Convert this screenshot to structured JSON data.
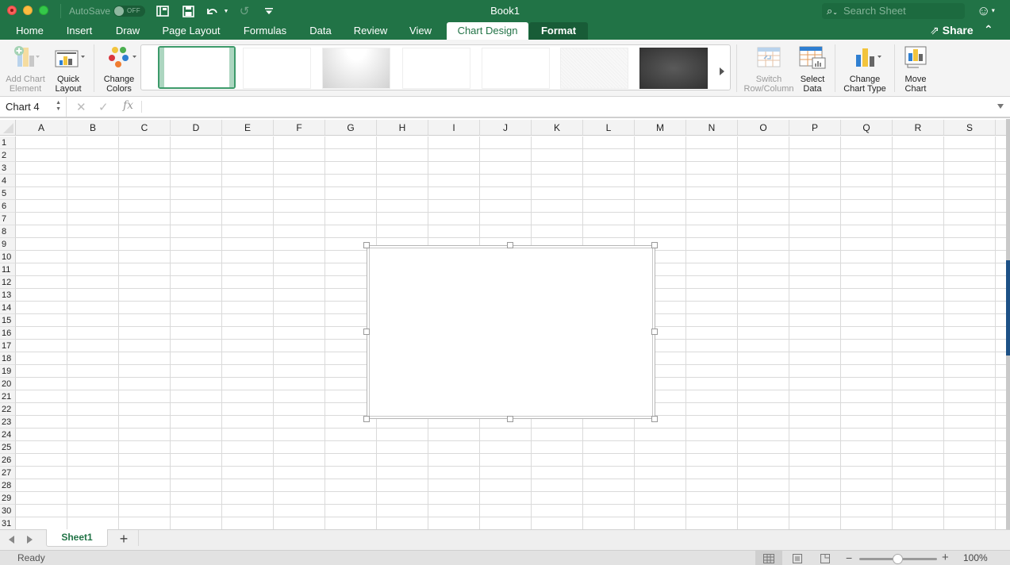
{
  "window": {
    "title": "Book1",
    "autosave_label": "AutoSave",
    "autosave_state": "OFF",
    "search_placeholder": "Search Sheet"
  },
  "quick_access": [
    {
      "name": "sidebar-toggle-icon",
      "glyph": "▯"
    },
    {
      "name": "save-icon",
      "glyph": "💾"
    },
    {
      "name": "undo-icon",
      "glyph": "↶"
    },
    {
      "name": "redo-icon",
      "glyph": "↻"
    },
    {
      "name": "customize-icon",
      "glyph": "⏷"
    }
  ],
  "tabs": [
    {
      "label": "Home"
    },
    {
      "label": "Insert"
    },
    {
      "label": "Draw"
    },
    {
      "label": "Page Layout"
    },
    {
      "label": "Formulas"
    },
    {
      "label": "Data"
    },
    {
      "label": "Review"
    },
    {
      "label": "View"
    },
    {
      "label": "Chart Design",
      "active": true
    },
    {
      "label": "Format"
    }
  ],
  "share_label": "Share",
  "ribbon": {
    "add_chart_element": {
      "line1": "Add Chart",
      "line2": "Element",
      "disabled": true
    },
    "quick_layout": {
      "line1": "Quick",
      "line2": "Layout"
    },
    "change_colors": {
      "line1": "Change",
      "line2": "Colors"
    },
    "chart_styles": [
      {
        "style": "Style 1",
        "selected": true
      },
      {
        "style": "Style 2"
      },
      {
        "style": "Style 3"
      },
      {
        "style": "Style 4"
      },
      {
        "style": "Style 5"
      },
      {
        "style": "Style 6"
      },
      {
        "style": "Style 7"
      }
    ],
    "switch_row_column": {
      "line1": "Switch",
      "line2": "Row/Column",
      "disabled": true
    },
    "select_data": {
      "line1": "Select",
      "line2": "Data"
    },
    "change_chart_type": {
      "line1": "Change",
      "line2": "Chart Type"
    },
    "move_chart": {
      "line1": "Move",
      "line2": "Chart"
    }
  },
  "formula_bar": {
    "name_box": "Chart 4",
    "cancel_glyph": "✕",
    "enter_glyph": "✓",
    "fx_label": "fx",
    "value": ""
  },
  "grid": {
    "columns": [
      "A",
      "B",
      "C",
      "D",
      "E",
      "F",
      "G",
      "H",
      "I",
      "J",
      "K",
      "L",
      "M",
      "N",
      "O",
      "P",
      "Q",
      "R",
      "S"
    ],
    "rows": [
      "1",
      "2",
      "3",
      "4",
      "5",
      "6",
      "7",
      "8",
      "9",
      "10",
      "11",
      "12",
      "13",
      "14",
      "15",
      "16",
      "17",
      "18",
      "19",
      "20",
      "21",
      "22",
      "23",
      "24",
      "25",
      "26",
      "27",
      "28",
      "29",
      "30",
      "31"
    ]
  },
  "chart": {
    "name": "Chart 4",
    "content": "empty"
  },
  "sheets": [
    {
      "label": "Sheet1",
      "active": true
    }
  ],
  "add_sheet_glyph": "+",
  "status": {
    "text": "Ready",
    "zoom": "100%",
    "zoom_fraction": 0.5,
    "view_mode": "normal"
  }
}
